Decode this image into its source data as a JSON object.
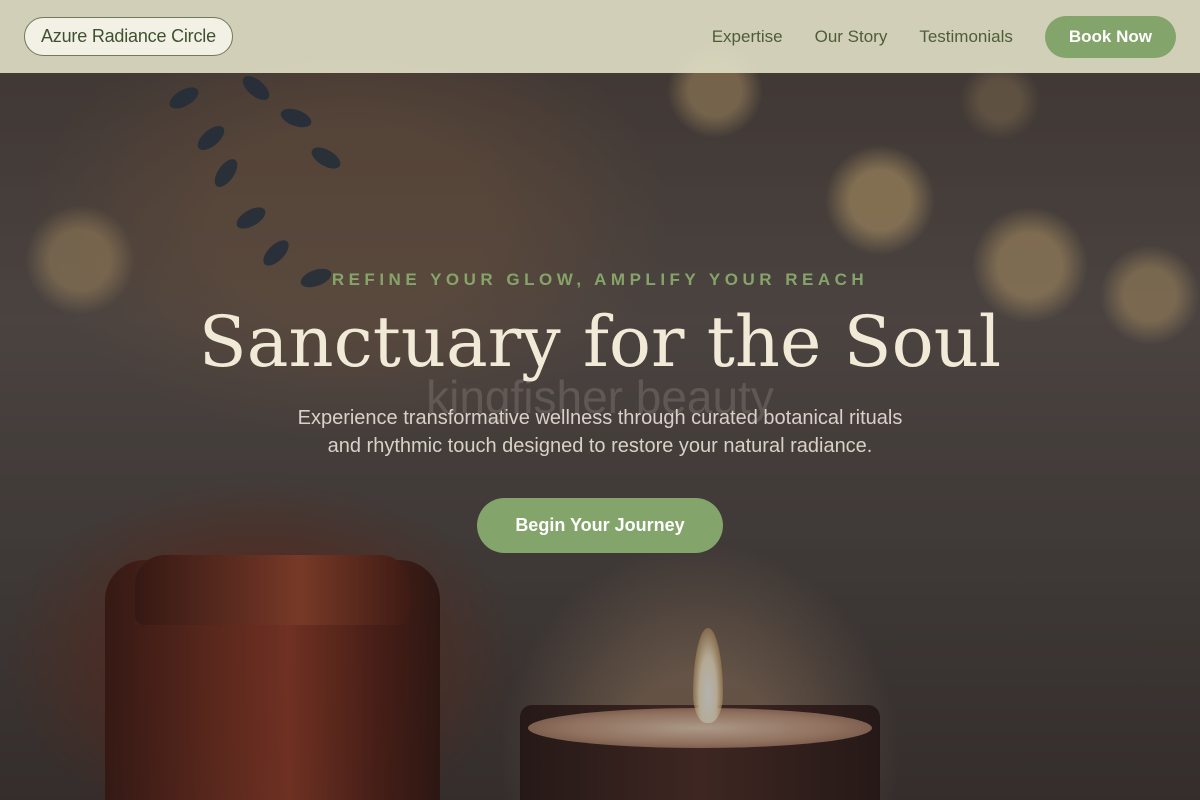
{
  "header": {
    "brand": "Azure Radiance Circle",
    "nav": [
      {
        "label": "Expertise"
      },
      {
        "label": "Our Story"
      },
      {
        "label": "Testimonials"
      }
    ],
    "book_label": "Book Now"
  },
  "hero": {
    "eyebrow": "REFINE YOUR GLOW, AMPLIFY YOUR REACH",
    "title": "Sanctuary for the Soul",
    "watermark": "kingfisher beauty",
    "subtitle_line1": "Experience transformative wellness through curated botanical rituals",
    "subtitle_line2": "and rhythmic touch designed to restore your natural radiance.",
    "cta_label": "Begin Your Journey"
  },
  "colors": {
    "accent": "#83a46a",
    "header_bg": "#dedcc4",
    "title": "#f1ead7"
  }
}
